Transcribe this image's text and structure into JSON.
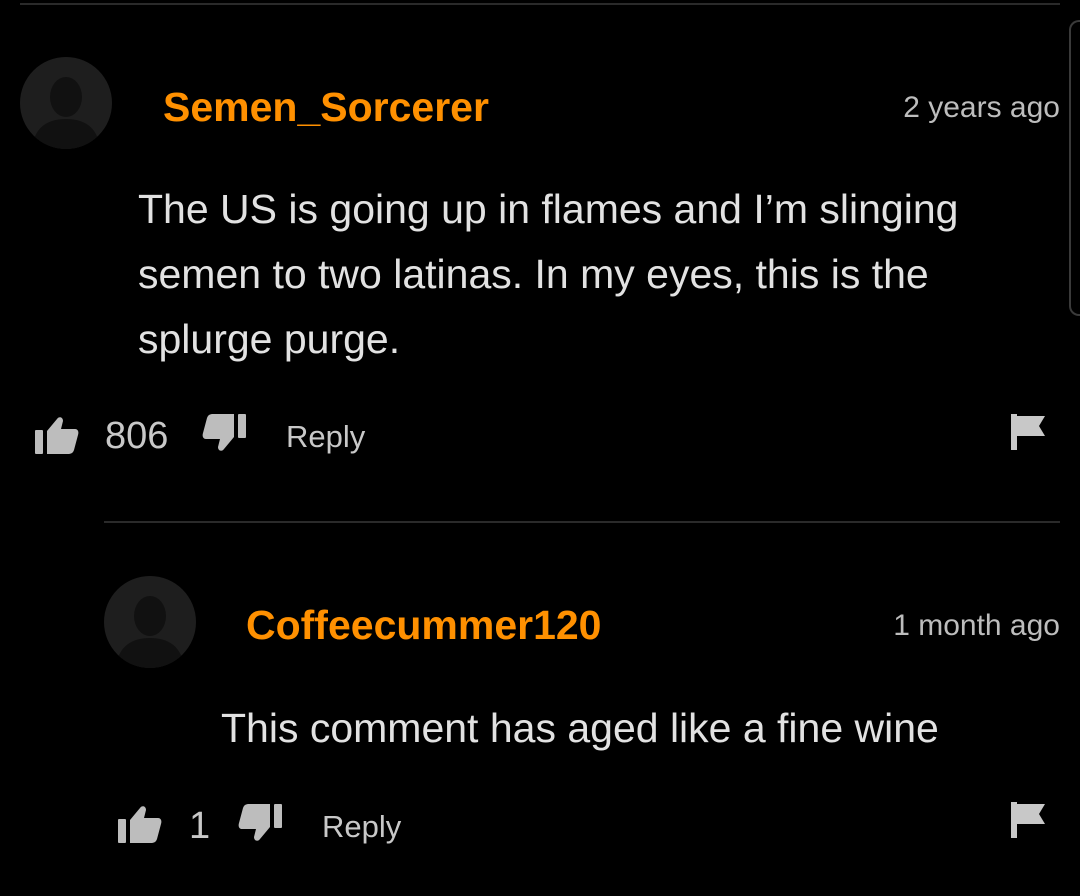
{
  "comments": [
    {
      "username": "Semen_Sorcerer",
      "timestamp": "2 years ago",
      "lines": [
        "The US is going up in flames and I’m slinging",
        "semen to two latinas. In my eyes, this is the",
        "splurge purge."
      ],
      "likes": "806",
      "reply_label": "Reply"
    },
    {
      "username": "Coffeecummer120",
      "timestamp": "1 month ago",
      "lines": [
        "This comment has aged like a fine wine"
      ],
      "likes": "1",
      "reply_label": "Reply"
    }
  ],
  "icons": {
    "avatar": "user-silhouette-icon",
    "like": "thumbs-up-icon",
    "dislike": "thumbs-down-icon",
    "report": "flag-icon"
  },
  "colors": {
    "background": "#000000",
    "username": "#ff9000",
    "text": "#e2e2e2",
    "muted": "#bdbdbd",
    "divider": "#2a2a2a"
  }
}
